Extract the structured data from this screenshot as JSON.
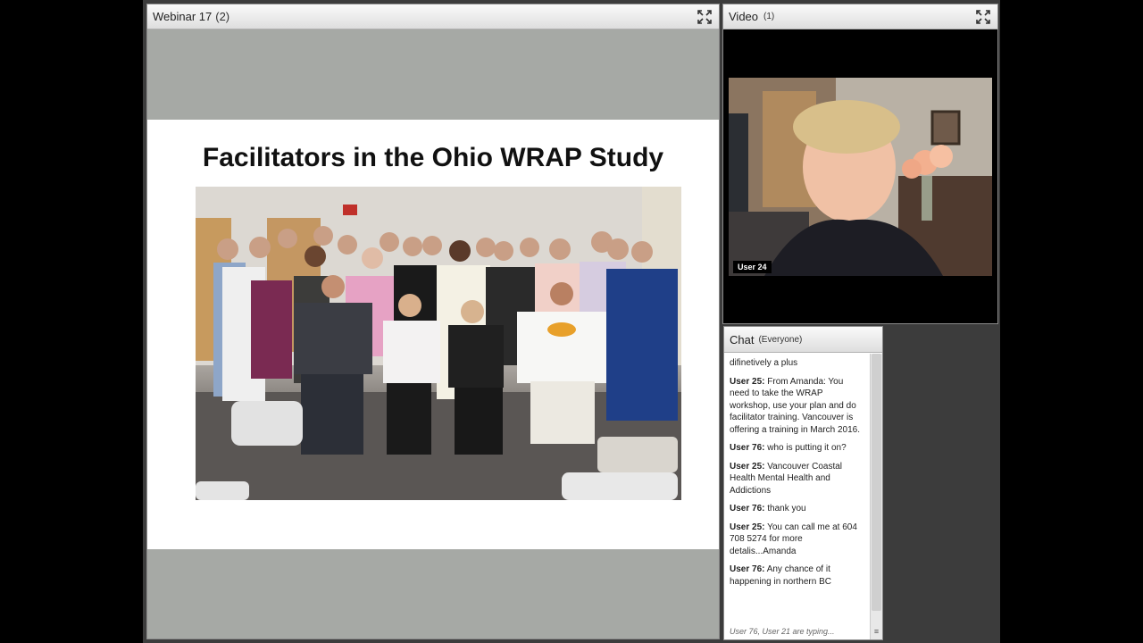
{
  "share_pod": {
    "title": "Webinar 17",
    "count": "(2)",
    "expand_icon": "fullscreen-icon"
  },
  "slide": {
    "title": "Facilitators in the Ohio WRAP Study",
    "photo_description": "group-photo"
  },
  "video_pod": {
    "title": "Video",
    "count": "(1)",
    "expand_icon": "fullscreen-icon",
    "speaker_label": "User 24"
  },
  "chat_pod": {
    "title": "Chat",
    "scope": "(Everyone)",
    "messages": [
      {
        "user": "",
        "text": "difinetively a plus"
      },
      {
        "user": "User 25:",
        "text": "From Amanda:  You need to take the WRAP workshop, use your plan and do facilitator training. Vancouver is offering a training in March 2016."
      },
      {
        "user": "User 76:",
        "text": "who is putting it on?"
      },
      {
        "user": "User 25:",
        "text": "Vancouver Coastal Health Mental Health and Addictions"
      },
      {
        "user": "User 76:",
        "text": "thank you"
      },
      {
        "user": "User 25:",
        "text": "You can call me at 604 708 5274 for more detalis...Amanda"
      },
      {
        "user": "User 76:",
        "text": "Any chance of it happening in northern BC"
      }
    ],
    "typing_status": "User 76, User 21 are typing..."
  }
}
